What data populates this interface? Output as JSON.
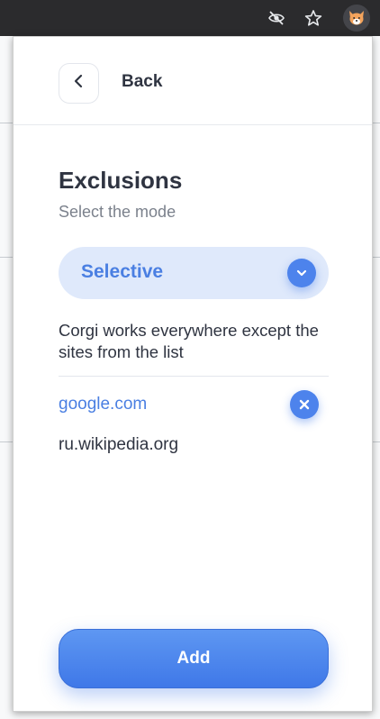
{
  "colors": {
    "accent": "#4d83ec",
    "accent_text": "#4a7fe2",
    "mode_background": "#dfe9fb",
    "text": "#2f3441",
    "muted": "#7b818c"
  },
  "browser": {
    "icons": [
      "eye-slash-icon",
      "star-icon",
      "corgi-extension-icon"
    ]
  },
  "header": {
    "back_icon": "chevron-left-icon",
    "back_label": "Back"
  },
  "exclusions": {
    "title": "Exclusions",
    "subtitle": "Select the mode",
    "mode": {
      "value": "Selective",
      "icon": "chevron-down-icon"
    },
    "description": "Corgi works everywhere except the sites from the list",
    "sites": [
      {
        "name": "google.com",
        "active": true,
        "action_icon": "remove-x-icon"
      },
      {
        "name": "ru.wikipedia.org",
        "active": false
      }
    ],
    "add_label": "Add"
  }
}
